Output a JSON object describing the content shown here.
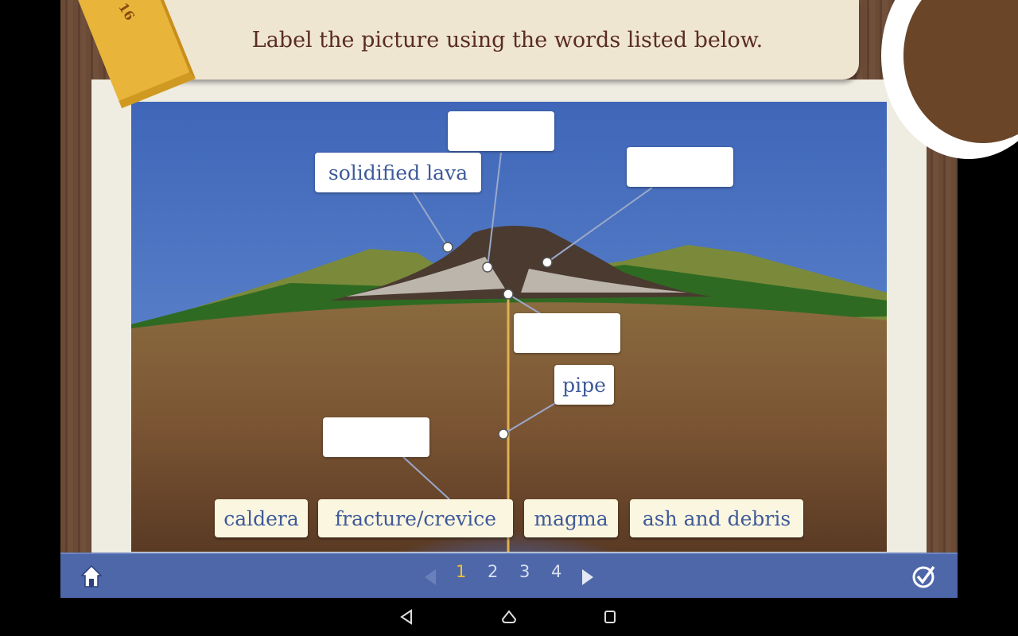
{
  "instruction": "Label the picture using the words listed below.",
  "ruler_number": "16",
  "placed_labels": [
    {
      "id": "solidified-lava",
      "text": "solidified lava"
    },
    {
      "id": "pipe",
      "text": "pipe"
    }
  ],
  "word_bank": [
    "caldera",
    "fracture/crevice",
    "magma",
    "ash and debris"
  ],
  "pagination": {
    "pages": [
      "1",
      "2",
      "3",
      "4"
    ],
    "current": "1"
  },
  "icons": {
    "home": "home-icon",
    "check": "check-circle-icon",
    "prev": "triangle-left-icon",
    "next": "triangle-right-icon"
  },
  "colors": {
    "bar": "#4d67a9",
    "current_page": "#f0c030",
    "label_text": "#3f5a9a"
  }
}
